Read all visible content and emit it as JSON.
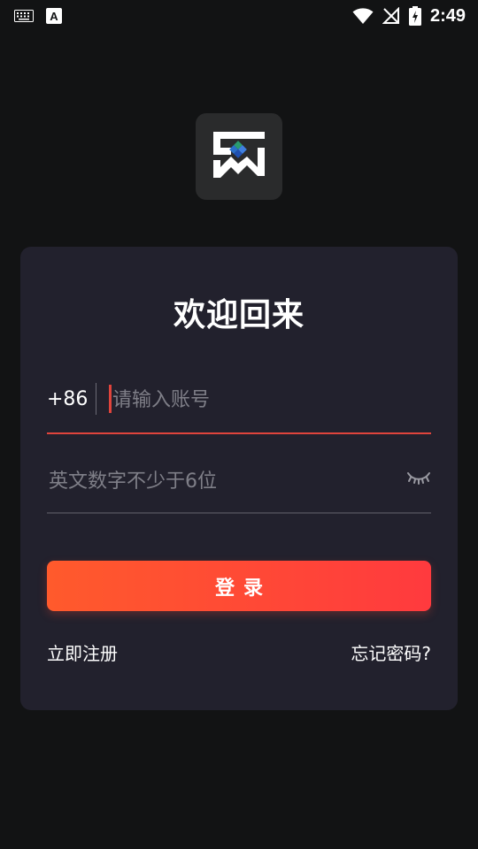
{
  "status_bar": {
    "time": "2:49",
    "icons": [
      "keyboard-icon",
      "font-a-icon",
      "wifi-icon",
      "no-signal-icon",
      "battery-charging-icon"
    ]
  },
  "logo": {
    "name": "app-logo-icon"
  },
  "login": {
    "title": "欢迎回来",
    "country_code": "+86",
    "account_placeholder": "请输入账号",
    "password_placeholder": "英文数字不少于6位",
    "login_button": "登录",
    "register_link": "立即注册",
    "forgot_link": "忘记密码?"
  },
  "colors": {
    "background": "#121314",
    "card": "#22212d",
    "accent": "#ff4a36",
    "input_active_line": "#e0443c"
  }
}
